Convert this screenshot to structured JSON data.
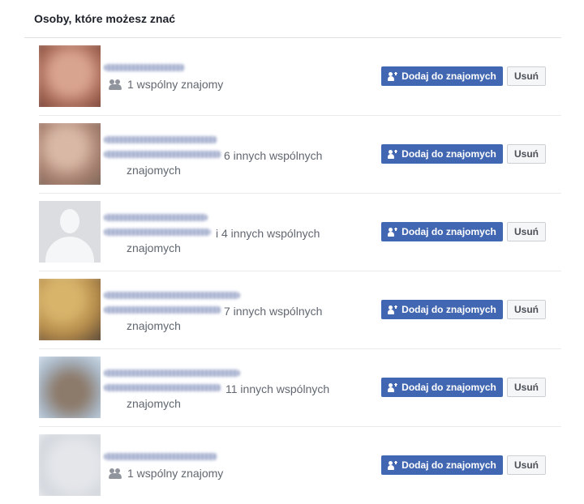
{
  "panel": {
    "title": "Osoby, które możesz znać"
  },
  "buttons": {
    "add_label": "Dodaj do znajomych",
    "remove_label": "Usuń"
  },
  "icons": {
    "mutual": "people-icon",
    "add": "add-friend-icon"
  },
  "colors": {
    "primary": "#4267b2",
    "muted_text": "#616770"
  },
  "suggestions": [
    {
      "mutual_line1": "1 wspólny znajomy",
      "mutual_line2": ""
    },
    {
      "mutual_line1": "6 innych wspólnych",
      "mutual_line2": "znajomych"
    },
    {
      "mutual_line1": "i 4 innych wspólnych",
      "mutual_line2": "znajomych"
    },
    {
      "mutual_line1": "7 innych wspólnych",
      "mutual_line2": "znajomych"
    },
    {
      "mutual_line1": "11 innych wspólnych",
      "mutual_line2": "znajomych"
    },
    {
      "mutual_line1": "1 wspólny znajomy",
      "mutual_line2": ""
    }
  ]
}
